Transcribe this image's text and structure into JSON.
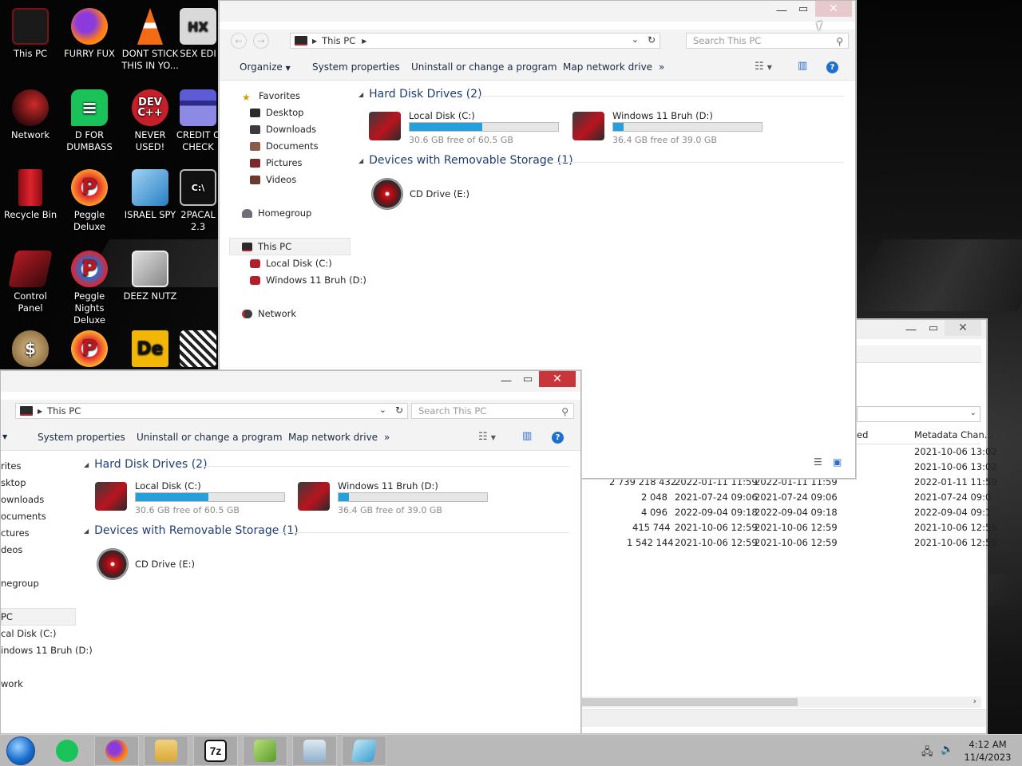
{
  "desktop": {
    "icons": [
      {
        "label": "This PC"
      },
      {
        "label": "FURRY FUX"
      },
      {
        "label": "DONT STICK THIS IN YO..."
      },
      {
        "label": "SEX EDI"
      },
      {
        "label": "Network"
      },
      {
        "label": "D FOR DUMBASS"
      },
      {
        "label": "NEVER USED!"
      },
      {
        "label": "CREDIT C CHECK"
      },
      {
        "label": "Recycle Bin"
      },
      {
        "label": "Peggle Deluxe"
      },
      {
        "label": "ISRAEL SPY"
      },
      {
        "label": "2PACAL 2.3"
      },
      {
        "label": "Control Panel"
      },
      {
        "label": "Peggle Nights Deluxe"
      },
      {
        "label": "DEEZ NUTZ"
      }
    ]
  },
  "explorer_top": {
    "address": "This PC",
    "search_placeholder": "Search This PC",
    "commands": {
      "organize": "Organize",
      "system_properties": "System properties",
      "uninstall": "Uninstall or change a program",
      "map_drive": "Map network drive",
      "more": "»"
    },
    "nav": {
      "favorites": "Favorites",
      "desktop": "Desktop",
      "downloads": "Downloads",
      "documents": "Documents",
      "pictures": "Pictures",
      "videos": "Videos",
      "homegroup": "Homegroup",
      "this_pc": "This PC",
      "local_disk": "Local Disk (C:)",
      "windows11": "Windows 11 Bruh (D:)",
      "network": "Network"
    },
    "groups": {
      "hdd": "Hard Disk Drives (2)",
      "removable": "Devices with Removable Storage (1)"
    },
    "drives": [
      {
        "name": "Local Disk (C:)",
        "free": "30.6 GB free of 60.5 GB",
        "used_fraction": 0.49
      },
      {
        "name": "Windows 11 Bruh (D:)",
        "free": "36.4 GB free of 39.0 GB",
        "used_fraction": 0.07
      }
    ],
    "cd": {
      "name": "CD Drive (E:)"
    }
  },
  "explorer_bottom": {
    "address": "This PC",
    "search_placeholder": "Search This PC",
    "commands": {
      "system_properties": "System properties",
      "uninstall": "Uninstall or change a program",
      "map_drive": "Map network drive",
      "more": "»"
    },
    "nav": {
      "favorites": "rites",
      "desktop": "sktop",
      "downloads": "ownloads",
      "documents": "ocuments",
      "pictures": "ctures",
      "videos": "deos",
      "homegroup": "negroup",
      "this_pc": "PC",
      "local_disk": "cal Disk (C:)",
      "windows11": "indows 11 Bruh (D:)",
      "network": "work"
    },
    "groups": {
      "hdd": "Hard Disk Drives (2)",
      "removable": "Devices with Removable Storage (1)"
    },
    "drives": [
      {
        "name": "Local Disk (C:)",
        "free": "30.6 GB free of 60.5 GB",
        "used_fraction": 0.49
      },
      {
        "name": "Windows 11 Bruh (D:)",
        "free": "36.4 GB free of 39.0 GB",
        "used_fraction": 0.07
      }
    ],
    "cd": {
      "name": "CD Drive (E:)"
    }
  },
  "detail_window": {
    "col_partial": "ed",
    "col_metadata": "Metadata Chan...",
    "top_rows": [
      "2021-10-06 13:02",
      "2021-10-06 13:02"
    ],
    "rows": [
      {
        "size": "2 739 218 432",
        "a": "2022-01-11 11:59",
        "b": "2022-01-11 11:59",
        "c": "2022-01-11 11:59"
      },
      {
        "size": "2 048",
        "a": "2021-07-24 09:06",
        "b": "2021-07-24 09:06",
        "c": "2021-07-24 09:0"
      },
      {
        "size": "4 096",
        "a": "2022-09-04 09:18",
        "b": "2022-09-04 09:18",
        "c": "2022-09-04 09:1"
      },
      {
        "size": "415 744",
        "a": "2021-10-06 12:59",
        "b": "2021-10-06 12:59",
        "c": "2021-10-06 12:59"
      },
      {
        "size": "1 542 144",
        "a": "2021-10-06 12:59",
        "b": "2021-10-06 12:59",
        "c": "2021-10-06 12:59"
      }
    ]
  },
  "taskbar": {
    "time": "4:12 AM",
    "date": "11/4/2023",
    "apps": [
      "start-orb",
      "notes-app",
      "firefox",
      "file-explorer",
      "7zip",
      "notepad-plus",
      "monitor-app",
      "tool-app"
    ]
  }
}
